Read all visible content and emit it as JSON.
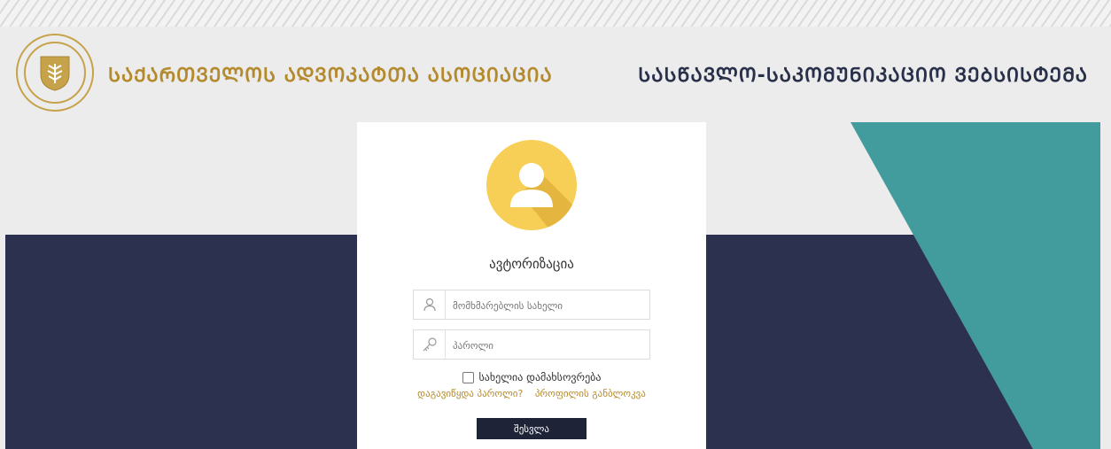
{
  "header": {
    "org_title": "ᲡᲐᲥᲐᲠᲗᲕᲔᲚᲝᲡ ᲐᲓᲕᲝᲙᲐᲢᲗᲐ ᲐᲡᲝᲪᲘᲐᲪᲘᲐ",
    "system_title": "ᲡᲐᲡᲬᲐᲕᲚᲝ-ᲡᲐᲙᲝᲛᲣᲜᲘᲙᲐᲪᲘᲝ ᲕᲔᲑᲡᲘᲡᲢᲔᲛᲐ",
    "logo_icon": "association-emblem-icon"
  },
  "login": {
    "heading": "ავტორიზაცია",
    "username": {
      "placeholder": "მომხმარებლის სახელი",
      "value": "",
      "icon": "user-icon"
    },
    "password": {
      "placeholder": "პაროლი",
      "value": "",
      "icon": "key-icon"
    },
    "remember_label": "სახელია დამახსოვრება",
    "forgot_password": "დაგავიწყდა პაროლი?",
    "profile_restore": "პროფილის განბლოკვა",
    "submit_label": "შესვლა"
  },
  "colors": {
    "gold": "#b48a2e",
    "navy": "#2d3150",
    "teal": "#429c9e",
    "avatar": "#f7cf56"
  }
}
